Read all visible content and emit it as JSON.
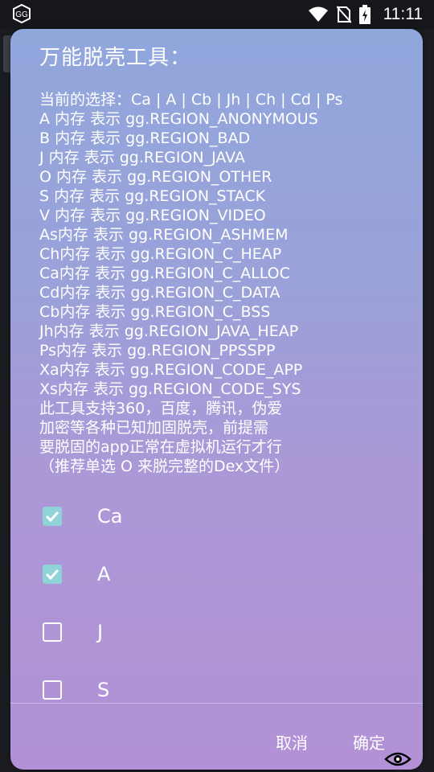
{
  "status": {
    "time": "11:11",
    "app_icon": "gg-icon",
    "icons": [
      "wifi-icon",
      "no-sim-icon",
      "battery-charging-icon"
    ]
  },
  "dialog": {
    "title": "万能脱壳工具：",
    "message_lines": [
      "当前的选择：Ca | A | Cb | Jh | Ch | Cd | Ps",
      "A 内存 表示 gg.REGION_ANONYMOUS",
      "B 内存 表示 gg.REGION_BAD",
      "J 内存 表示 gg.REGION_JAVA",
      "O 内存 表示 gg.REGION_OTHER",
      "S 内存 表示 gg.REGION_STACK",
      "V 内存 表示 gg.REGION_VIDEO",
      "As内存 表示 gg.REGION_ASHMEM",
      "Ch内存 表示 gg.REGION_C_HEAP",
      "Ca内存 表示 gg.REGION_C_ALLOC",
      "Cd内存 表示 gg.REGION_C_DATA",
      "Cb内存 表示 gg.REGION_C_BSS",
      "Jh内存 表示 gg.REGION_JAVA_HEAP",
      "Ps内存 表示 gg.REGION_PPSSPP",
      "Xa内存 表示 gg.REGION_CODE_APP",
      "Xs内存 表示 gg.REGION_CODE_SYS",
      "此工具支持360，百度，腾讯，伪爱",
      "加密等各种已知加固脱壳，前提需",
      "要脱固的app正常在虚拟机运行才行",
      "（推荐单选 O 来脱完整的Dex文件）"
    ],
    "options": [
      {
        "label": "Ca",
        "checked": true
      },
      {
        "label": "A",
        "checked": true
      },
      {
        "label": "J",
        "checked": false
      },
      {
        "label": "S",
        "checked": false
      }
    ],
    "cancel_label": "取消",
    "ok_label": "确定"
  }
}
